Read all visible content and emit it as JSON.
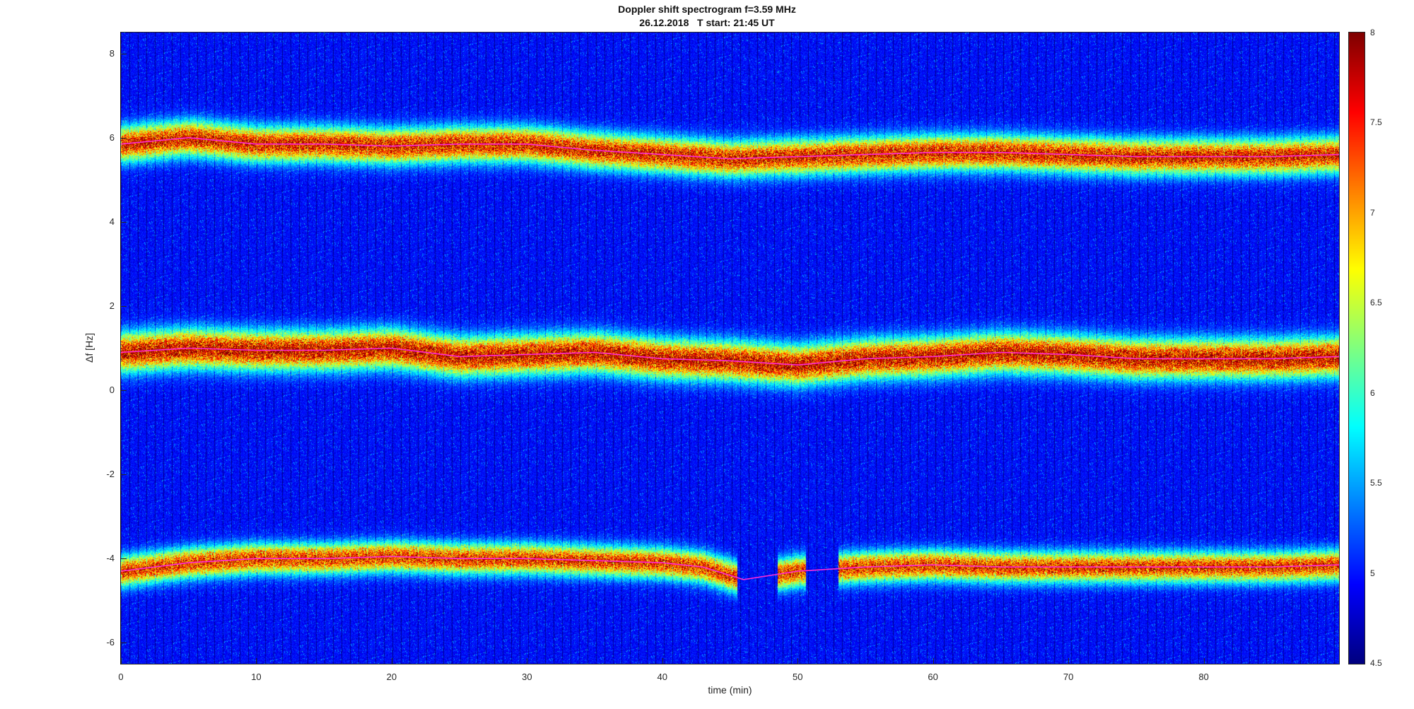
{
  "chart_data": {
    "type": "heatmap",
    "title": "Doppler shift spectrogram f=3.59 MHz",
    "subtitle": "26.12.2018   T start: 21:45 UT",
    "xlabel": "time (min)",
    "ylabel": "Δf [Hz]",
    "xlim": [
      0,
      90
    ],
    "ylim": [
      -6.5,
      8.5
    ],
    "x_ticks": [
      "0",
      "10",
      "20",
      "30",
      "40",
      "50",
      "60",
      "70",
      "80"
    ],
    "y_ticks": [
      "8",
      "6",
      "4",
      "2",
      "0",
      "-2",
      "-4",
      "-6"
    ],
    "colorbar": {
      "colormap": "jet",
      "range": [
        4.5,
        8
      ],
      "ticks": [
        "8",
        "7.5",
        "7",
        "6.5",
        "6",
        "5.5",
        "5",
        "4.5"
      ]
    },
    "series": [
      {
        "band": "upper",
        "x": [
          0,
          5,
          10,
          15,
          20,
          25,
          30,
          35,
          40,
          45,
          50,
          55,
          60,
          65,
          70,
          75,
          80,
          85,
          90
        ],
        "y": [
          5.85,
          6.0,
          5.85,
          5.85,
          5.8,
          5.85,
          5.85,
          5.7,
          5.6,
          5.5,
          5.55,
          5.6,
          5.65,
          5.65,
          5.6,
          5.55,
          5.55,
          5.55,
          5.6
        ]
      },
      {
        "band": "middle",
        "x": [
          0,
          5,
          10,
          15,
          20,
          25,
          30,
          35,
          40,
          45,
          50,
          55,
          60,
          65,
          70,
          75,
          80,
          85,
          90
        ],
        "y": [
          0.9,
          1.0,
          0.95,
          0.95,
          1.0,
          0.8,
          0.85,
          0.9,
          0.75,
          0.7,
          0.6,
          0.75,
          0.8,
          0.9,
          0.85,
          0.75,
          0.75,
          0.75,
          0.8
        ]
      },
      {
        "band": "lower",
        "x": [
          0,
          5,
          10,
          15,
          20,
          25,
          30,
          35,
          40,
          43,
          46,
          50,
          55,
          60,
          65,
          70,
          75,
          80,
          85,
          90
        ],
        "y": [
          -4.3,
          -4.1,
          -4.0,
          -4.0,
          -3.95,
          -4.0,
          -4.0,
          -4.05,
          -4.1,
          -4.2,
          -4.5,
          -4.3,
          -4.2,
          -4.15,
          -4.2,
          -4.2,
          -4.2,
          -4.2,
          -4.2,
          -4.15
        ]
      }
    ],
    "gaps_min": [
      [
        45.5,
        48.5
      ],
      [
        50.6,
        53.0
      ]
    ]
  }
}
